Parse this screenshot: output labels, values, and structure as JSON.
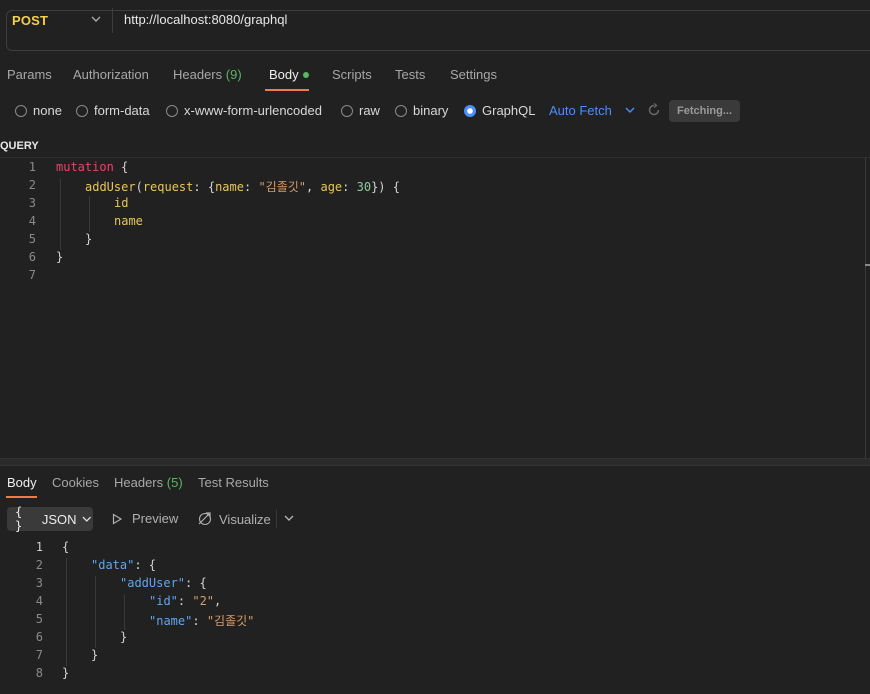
{
  "request": {
    "method": "POST",
    "url": "http://localhost:8080/graphql"
  },
  "request_tabs": {
    "params": "Params",
    "authorization": "Authorization",
    "headers": "Headers",
    "headers_count": "(9)",
    "body": "Body",
    "scripts": "Scripts",
    "tests": "Tests",
    "settings": "Settings"
  },
  "body_types": {
    "none": "none",
    "form_data": "form-data",
    "urlencoded": "x-www-form-urlencoded",
    "raw": "raw",
    "binary": "binary",
    "graphql": "GraphQL",
    "selected": "GraphQL"
  },
  "auto_fetch": "Auto Fetch",
  "fetching": "Fetching...",
  "query_label": "QUERY",
  "query_lines": [
    "1",
    "2",
    "3",
    "4",
    "5",
    "6",
    "7"
  ],
  "query_code": {
    "l1_kw": "mutation",
    "l1_brace": " {",
    "l2_fn": "addUser",
    "l2_p1": "(",
    "l2_arg1": "request",
    "l2_p2": ": {",
    "l2_arg2": "name",
    "l2_p3": ": ",
    "l2_str": "\"김졸깃\"",
    "l2_p4": ", ",
    "l2_arg3": "age",
    "l2_p5": ": ",
    "l2_num": "30",
    "l2_p6": "}) {",
    "l3": "id",
    "l4": "name",
    "l5": "}",
    "l6": "}"
  },
  "response_tabs": {
    "body": "Body",
    "cookies": "Cookies",
    "headers": "Headers",
    "headers_count": "(5)",
    "test_results": "Test Results"
  },
  "response_format": {
    "json": "JSON",
    "preview": "Preview",
    "visualize": "Visualize"
  },
  "response_lines": [
    "1",
    "2",
    "3",
    "4",
    "5",
    "6",
    "7",
    "8"
  ],
  "response_code": {
    "l1": "{",
    "l2_key": "\"data\"",
    "l2_rest": ": {",
    "l3_key": "\"addUser\"",
    "l3_rest": ": {",
    "l4_key": "\"id\"",
    "l4_colon": ": ",
    "l4_val": "\"2\"",
    "l4_comma": ",",
    "l5_key": "\"name\"",
    "l5_colon": ": ",
    "l5_val": "\"김졸깃\"",
    "l6": "}",
    "l7": "}",
    "l8": "}"
  },
  "colors": {
    "method": "#f5d04a",
    "accent_tab": "#ef7b45",
    "link_blue": "#4c8dff",
    "count_green": "#5ab663",
    "keyword": "#e8446d",
    "string": "#d69d6f",
    "json_key": "#5fa6f0"
  }
}
